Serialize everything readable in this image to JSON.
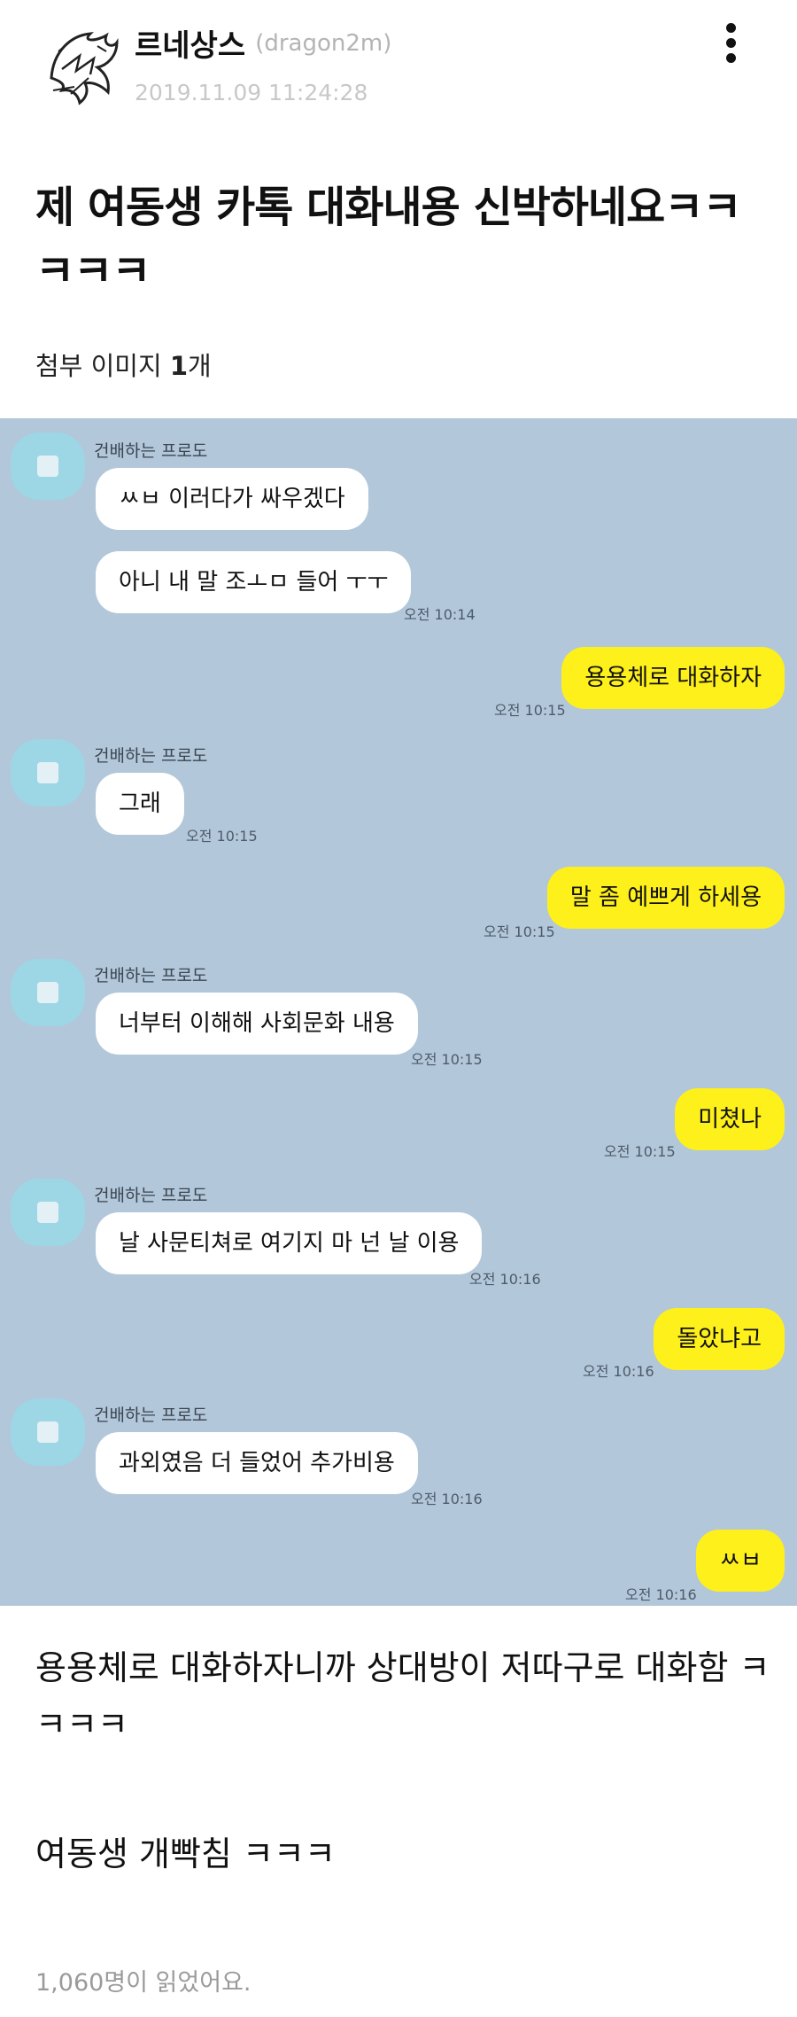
{
  "author": {
    "name": "르네상스",
    "id": "(dragon2m)",
    "date": "2019.11.09 11:24:28",
    "avatar_icon": "dragon-logo-icon"
  },
  "menu_icon": "more-vertical-icon",
  "title": "제 여동생 카톡 대화내용 신박하네요ㅋㅋㅋㅋㅋ",
  "attachment": {
    "prefix": "첨부 이미지 ",
    "count": "1",
    "suffix": "개"
  },
  "chat": {
    "background": "#b2c7da",
    "incoming_color": "#ffffff",
    "outgoing_color": "#fef01b",
    "messages": [
      {
        "side": "in",
        "sender": "건배하는 프로도",
        "text": "ㅆㅂ 이러다가 싸우겠다",
        "time": ""
      },
      {
        "side": "in",
        "sender": "",
        "text": "아니 내 말 조ㅗㅁ 들어 ㅜㅜ",
        "time": "오전 10:14"
      },
      {
        "side": "out",
        "sender": "",
        "text": "용용체로 대화하자",
        "time": "오전 10:15"
      },
      {
        "side": "in",
        "sender": "건배하는 프로도",
        "text": "그래",
        "time": "오전 10:15"
      },
      {
        "side": "out",
        "sender": "",
        "text": "말 좀 예쁘게 하세용",
        "time": "오전 10:15"
      },
      {
        "side": "in",
        "sender": "건배하는 프로도",
        "text": "너부터 이해해 사회문화 내용",
        "time": "오전 10:15"
      },
      {
        "side": "out",
        "sender": "",
        "text": "미쳤나",
        "time": "오전 10:15"
      },
      {
        "side": "in",
        "sender": "건배하는 프로도",
        "text": "날 사문티쳐로 여기지 마 넌 날 이용",
        "time": "오전 10:16"
      },
      {
        "side": "out",
        "sender": "",
        "text": "돌았냐고",
        "time": "오전 10:16"
      },
      {
        "side": "in",
        "sender": "건배하는 프로도",
        "text": "과외였음 더 들었어 추가비용",
        "time": "오전 10:16"
      },
      {
        "side": "out",
        "sender": "",
        "text": "ㅆㅂ",
        "time": "오전 10:16"
      }
    ]
  },
  "body": {
    "paragraph1": "용용체로 대화하자니까 상대방이 저따구로 대화함 ㅋㅋㅋㅋ",
    "paragraph2": "여동생 개빡침 ㅋㅋㅋ"
  },
  "read_count": "1,060명이 읽었어요."
}
